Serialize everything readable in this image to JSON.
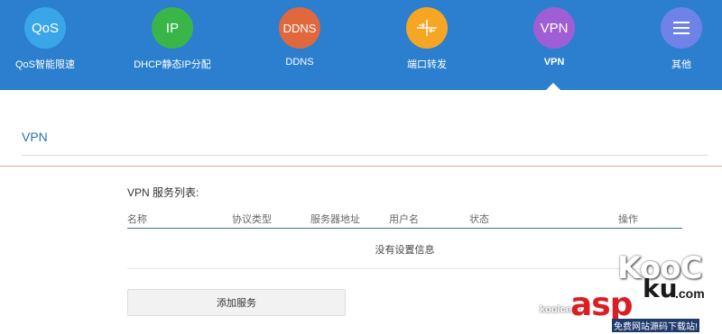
{
  "nav": {
    "items": [
      {
        "icon_text": "QoS",
        "label": "QoS智能限速",
        "color": "#3aa6ea",
        "icon": "qos-icon"
      },
      {
        "icon_text": "IP",
        "label": "DHCP静态IP分配",
        "color": "#39b54a",
        "icon": "ip-icon"
      },
      {
        "icon_text": "DDNS",
        "label": "DDNS",
        "color": "#e0683c",
        "icon": "ddns-icon"
      },
      {
        "icon_text": "",
        "label": "端口转发",
        "color": "#f6a623",
        "icon": "port-forward-icon"
      },
      {
        "icon_text": "VPN",
        "label": "VPN",
        "color": "#a05ed6",
        "icon": "vpn-icon"
      },
      {
        "icon_text": "",
        "label": "其他",
        "color": "#6f82e8",
        "icon": "menu-icon"
      }
    ],
    "active": "VPN",
    "bg_color": "#2c7fce"
  },
  "section": {
    "title": "VPN"
  },
  "list": {
    "title": "VPN 服务列表:",
    "columns": [
      "名称",
      "协议类型",
      "服务器地址",
      "用户名",
      "状态",
      "操作"
    ],
    "empty_text": "没有设置信息"
  },
  "add_button": {
    "label": "添加服务"
  },
  "watermark": {
    "kooc": "KooC",
    "koolcenter": "koolcenter",
    "asp": "asp",
    "ku": "ku",
    "com": ".com",
    "sub": "免费网站源码下载站!"
  }
}
